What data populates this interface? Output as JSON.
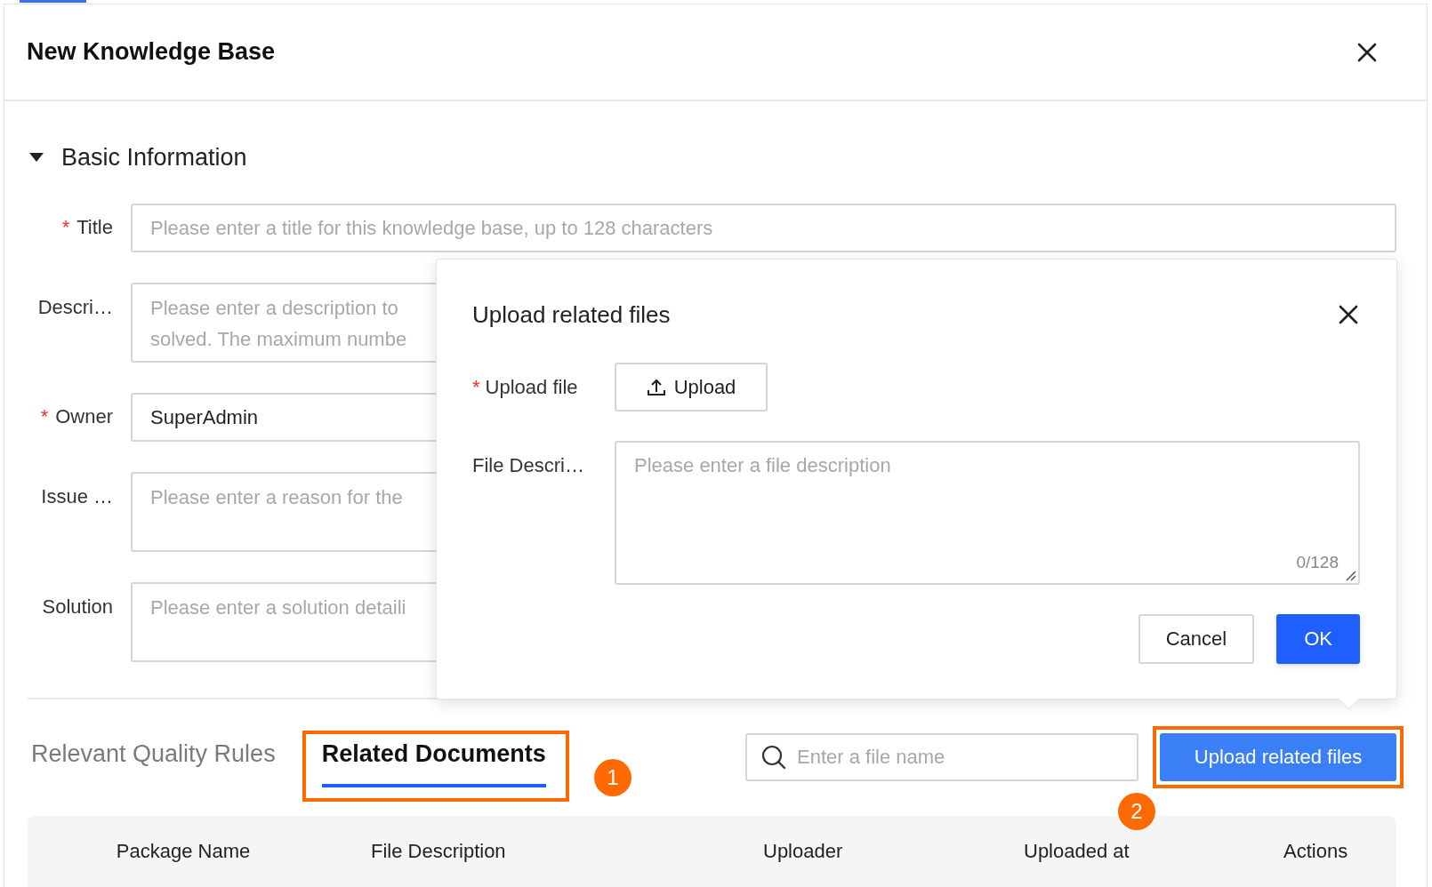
{
  "dialog": {
    "title": "New Knowledge Base"
  },
  "section": {
    "title": "Basic Information",
    "expanded": true
  },
  "fields": [
    {
      "kind": "input",
      "label": "Title",
      "required_mark": "*",
      "placeholder": "Please enter a title for this knowledge base, up to 128 characters"
    },
    {
      "kind": "textarea",
      "label": "Descri…",
      "placeholder": "Please enter a description to\nsolved. The maximum numbe"
    },
    {
      "kind": "input",
      "label": "Owner",
      "required_mark": "*",
      "value": "SuperAdmin"
    },
    {
      "kind": "textarea",
      "label": "Issue …",
      "placeholder": "Please enter a reason for the"
    },
    {
      "kind": "textarea",
      "label": "Solution",
      "placeholder": "Please enter a solution detaili"
    }
  ],
  "tabs": [
    {
      "label": "Relevant Quality Rules",
      "selected": false,
      "highlighted": false
    },
    {
      "label": "Related Documents",
      "selected": true,
      "highlighted": true
    }
  ],
  "search": {
    "placeholder": "Enter a file name"
  },
  "upload_button": {
    "label": "Upload related files",
    "highlighted": true
  },
  "callouts": [
    "1",
    "2"
  ],
  "table": {
    "columns": [
      "Package Name",
      "File Description",
      "Uploader",
      "Uploaded at",
      "Actions"
    ]
  },
  "popover": {
    "title": "Upload related files",
    "fields": [
      {
        "kind": "upload",
        "label": "Upload file",
        "required_mark": "*",
        "button": "Upload"
      },
      {
        "kind": "textarea",
        "label": "File Descri…",
        "placeholder": "Please enter a file description",
        "counter": "0/128"
      }
    ],
    "buttons": [
      {
        "label": "Cancel",
        "primary": false
      },
      {
        "label": "OK",
        "primary": true
      }
    ]
  }
}
